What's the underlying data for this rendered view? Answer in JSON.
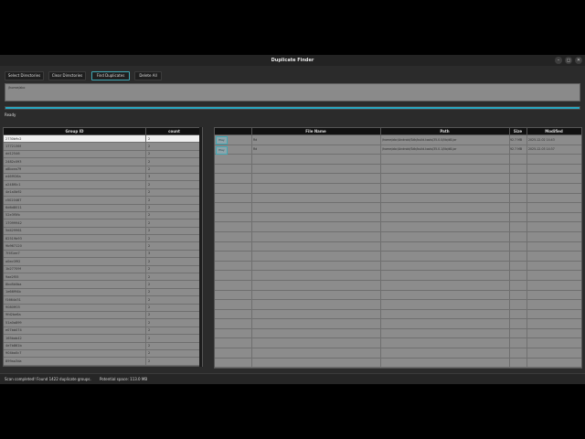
{
  "window": {
    "title": "Duplicate Finder",
    "controls": {
      "minimize": "–",
      "maximize": "◻",
      "close": "✕"
    }
  },
  "toolbar": {
    "select_dirs": "Select Directories",
    "clear_dirs": "Clear Directories",
    "find_dups": "Find Duplicates",
    "delete_all": "Delete All"
  },
  "directories": {
    "text": "/home/abc"
  },
  "progress": {
    "value": 1.0,
    "color": "#2aa6c0"
  },
  "status_top": "Ready",
  "groups_table": {
    "headers": {
      "group_id": "Group ID",
      "count": "count"
    },
    "rows": [
      {
        "id": "2730b9c2",
        "count": "2"
      },
      {
        "id": "1772136f",
        "count": "2"
      },
      {
        "id": "dd12546",
        "count": "2"
      },
      {
        "id": "2482c093",
        "count": "2"
      },
      {
        "id": "a8bcea79",
        "count": "2"
      },
      {
        "id": "e46f926a",
        "count": "3"
      },
      {
        "id": "a248f0c1",
        "count": "2"
      },
      {
        "id": "4e1a0b92",
        "count": "2"
      },
      {
        "id": "c5020467",
        "count": "2"
      },
      {
        "id": "6d6d8011",
        "count": "2"
      },
      {
        "id": "52e3f5fb",
        "count": "2"
      },
      {
        "id": "17099942",
        "count": "2"
      },
      {
        "id": "5d429961",
        "count": "2"
      },
      {
        "id": "82519b93",
        "count": "2"
      },
      {
        "id": "9b967120",
        "count": "2"
      },
      {
        "id": "7f4f1ee7",
        "count": "3"
      },
      {
        "id": "a0ec0f92",
        "count": "2"
      },
      {
        "id": "1b27709f",
        "count": "2"
      },
      {
        "id": "9ae2f55",
        "count": "2"
      },
      {
        "id": "8bc8b0ba",
        "count": "2"
      },
      {
        "id": "1e66f94b",
        "count": "2"
      },
      {
        "id": "f1664d31",
        "count": "2"
      },
      {
        "id": "9080ff03",
        "count": "2"
      },
      {
        "id": "9fd2be6a",
        "count": "2"
      },
      {
        "id": "51a0a899",
        "count": "2"
      },
      {
        "id": "e07bb074",
        "count": "2"
      },
      {
        "id": "165bab42",
        "count": "2"
      },
      {
        "id": "4e7b861b",
        "count": "2"
      },
      {
        "id": "904ba0c7",
        "count": "2"
      },
      {
        "id": "899aa3da",
        "count": "2"
      }
    ]
  },
  "files_table": {
    "headers": {
      "file_name": "File Name",
      "path": "Path",
      "size": "Size",
      "modified": "Modified"
    },
    "play_label": "Play",
    "rows": [
      {
        "name": "Rd",
        "path": "/home/abc/Android/Sdk/build-tools/35.0.0/lib/d8.jar",
        "size": "92.7 MB",
        "modified": "2025-12-02 14:43"
      },
      {
        "name": "Rd",
        "path": "/home/abc/Android/Sdk/build-tools/35.0.1/lib/d8.jar",
        "size": "92.7 MB",
        "modified": "2025-12-03 14:37"
      }
    ]
  },
  "statusbar": {
    "scan_text": "Scan completed! Found 1422 duplicate groups.",
    "space_text": "Potential space: 113.0 MB"
  }
}
